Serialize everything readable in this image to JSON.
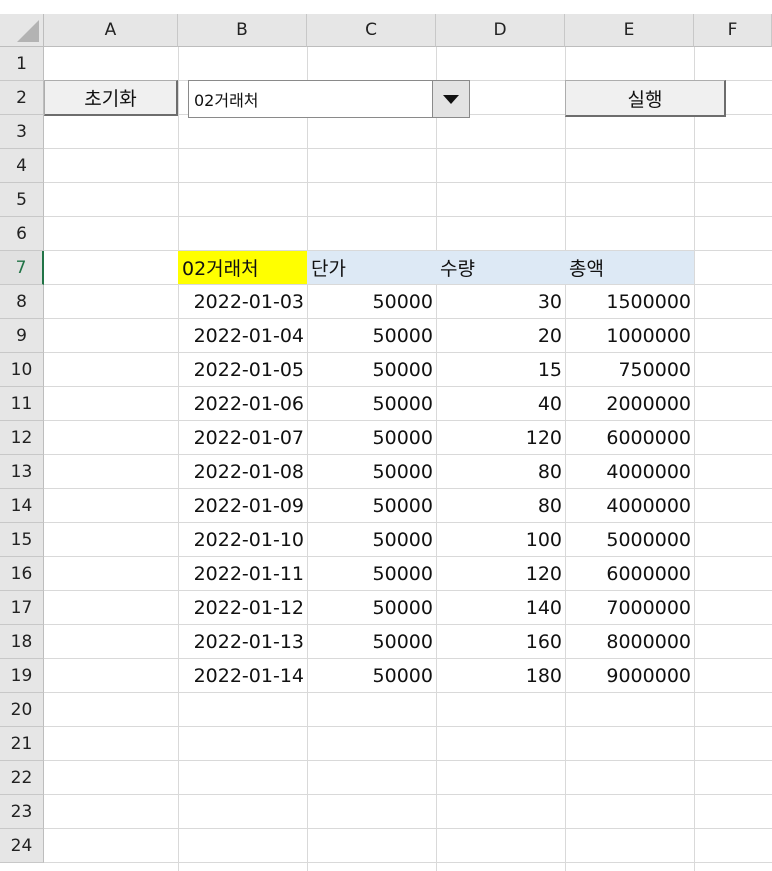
{
  "columns": [
    "A",
    "B",
    "C",
    "D",
    "E",
    "F"
  ],
  "rows": [
    "1",
    "2",
    "3",
    "4",
    "5",
    "6",
    "7",
    "8",
    "9",
    "10",
    "11",
    "12",
    "13",
    "14",
    "15",
    "16",
    "17",
    "18",
    "19",
    "20",
    "21",
    "22",
    "23",
    "24"
  ],
  "active_row": "7",
  "controls": {
    "reset_button_label": "초기화",
    "client_select_value": "02거래처",
    "run_button_label": "실행"
  },
  "table": {
    "headers": [
      "02거래처",
      "단가",
      "수량",
      "총액"
    ],
    "header_highlight_color": "#ffff00",
    "header_band_color": "#dde9f5",
    "rows": [
      [
        "2022-01-03",
        "50000",
        "30",
        "1500000"
      ],
      [
        "2022-01-04",
        "50000",
        "20",
        "1000000"
      ],
      [
        "2022-01-05",
        "50000",
        "15",
        "750000"
      ],
      [
        "2022-01-06",
        "50000",
        "40",
        "2000000"
      ],
      [
        "2022-01-07",
        "50000",
        "120",
        "6000000"
      ],
      [
        "2022-01-08",
        "50000",
        "80",
        "4000000"
      ],
      [
        "2022-01-09",
        "50000",
        "80",
        "4000000"
      ],
      [
        "2022-01-10",
        "50000",
        "100",
        "5000000"
      ],
      [
        "2022-01-11",
        "50000",
        "120",
        "6000000"
      ],
      [
        "2022-01-12",
        "50000",
        "140",
        "7000000"
      ],
      [
        "2022-01-13",
        "50000",
        "160",
        "8000000"
      ],
      [
        "2022-01-14",
        "50000",
        "180",
        "9000000"
      ]
    ]
  },
  "icons": {
    "select_all": "select-all-triangle-icon",
    "dropdown": "dropdown-arrow-icon"
  }
}
